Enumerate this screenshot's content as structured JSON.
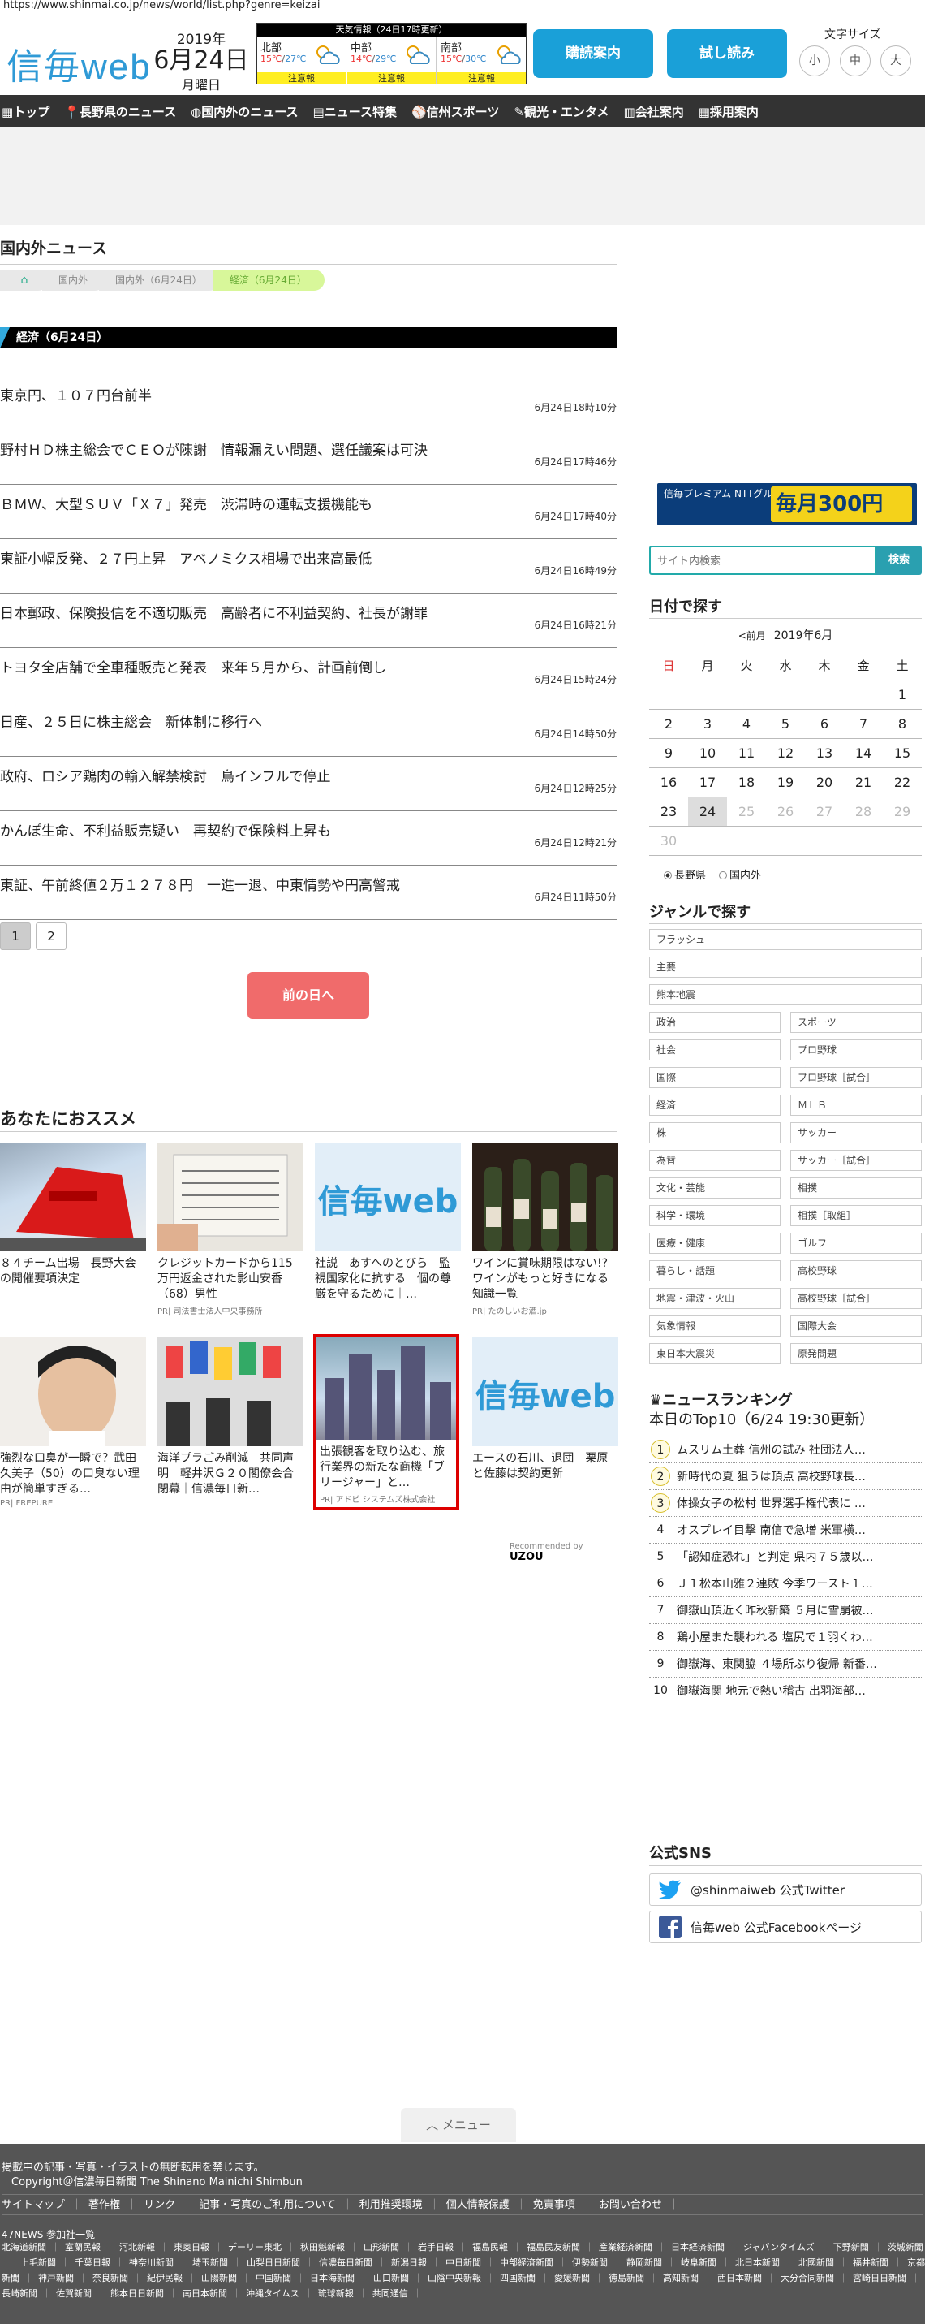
{
  "url": "https://www.shinmai.co.jp/news/world/list.php?genre=keizai",
  "header": {
    "logo_main": "信毎",
    "logo_web": "web",
    "date_year": "2019年",
    "date_main": "6月24日",
    "date_weekday": "月曜日",
    "weather_title": "天気情報（24日17時更新）",
    "weather": [
      {
        "region": "北部",
        "high": "15℃",
        "low": "27℃",
        "warning": "注意報"
      },
      {
        "region": "中部",
        "high": "14℃",
        "low": "29℃",
        "warning": "注意報"
      },
      {
        "region": "南部",
        "high": "15℃",
        "low": "30℃",
        "warning": "注意報"
      }
    ],
    "subscribe_label": "購読案内",
    "trial_label": "試し読み",
    "fontsize_label": "文字サイズ",
    "fontsize": [
      "小",
      "中",
      "大"
    ]
  },
  "nav": [
    {
      "icon": "home-icon",
      "label": "トップ"
    },
    {
      "icon": "pin-icon",
      "label": "長野県のニュース"
    },
    {
      "icon": "globe-icon",
      "label": "国内外のニュース"
    },
    {
      "icon": "document-icon",
      "label": "ニュース特集"
    },
    {
      "icon": "ball-icon",
      "label": "信州スポーツ"
    },
    {
      "icon": "camera-icon",
      "label": "観光・エンタメ"
    },
    {
      "icon": "building-icon",
      "label": "会社案内"
    },
    {
      "icon": "recruit-icon",
      "label": "採用案内"
    }
  ],
  "main": {
    "section_title": "国内外ニュース",
    "breadcrumbs": [
      "国内外",
      "国内外（6月24日）",
      "経済（6月24日）"
    ],
    "category_bar": "経済（6月24日）",
    "articles": [
      {
        "title": "東京円、１０７円台前半",
        "time": "6月24日18時10分"
      },
      {
        "title": "野村ＨＤ株主総会でＣＥＯが陳謝　情報漏えい問題、選任議案は可決",
        "time": "6月24日17時46分"
      },
      {
        "title": "ＢＭＷ、大型ＳＵＶ「Ｘ７」発売　渋滞時の運転支援機能も",
        "time": "6月24日17時40分"
      },
      {
        "title": "東証小幅反発、２７円上昇　アベノミクス相場で出来高最低",
        "time": "6月24日16時49分"
      },
      {
        "title": "日本郵政、保険投信を不適切販売　高齢者に不利益契約、社長が謝罪",
        "time": "6月24日16時21分"
      },
      {
        "title": "トヨタ全店舗で全車種販売と発表　来年５月から、計画前倒し",
        "time": "6月24日15時24分"
      },
      {
        "title": "日産、２５日に株主総会　新体制に移行へ",
        "time": "6月24日14時50分"
      },
      {
        "title": "政府、ロシア鶏肉の輸入解禁検討　鳥インフルで停止",
        "time": "6月24日12時25分"
      },
      {
        "title": "かんぽ生命、不利益販売疑い　再契約で保険料上昇も",
        "time": "6月24日12時21分"
      },
      {
        "title": "東証、午前終値２万１２７８円　一進一退、中東情勢や円高警戒",
        "time": "6月24日11時50分"
      }
    ],
    "pages": [
      "1",
      "2"
    ],
    "prev_day_label": "前の日へ",
    "recommend_title": "あなたにおススメ",
    "recommend": [
      {
        "title": "８４チーム出場　長野大会の開催要項決定",
        "pr": "",
        "img": "red-object"
      },
      {
        "title": "クレジットカードから115万円返金された影山安香（68）男性",
        "pr": "PR| 司法書士法人中央事務所",
        "img": "passbook"
      },
      {
        "title": "社説　あすへのとびら　監視国家化に抗する　個の尊厳を守るために｜…",
        "pr": "",
        "img": "logo"
      },
      {
        "title": "ワインに賞味期限はない!?ワインがもっと好きになる知識一覧",
        "pr": "PR| たのしいお酒.jp",
        "img": "wine"
      },
      {
        "title": "強烈な口臭が一瞬で？武田久美子（50）の口臭ない理由が簡単すぎる…",
        "pr": "PR| FREPURE",
        "img": "man"
      },
      {
        "title": "海洋プラごみ削減　共同声明　軽井沢Ｇ２０閣僚会合閉幕｜信濃毎日新…",
        "pr": "",
        "img": "flags"
      },
      {
        "title": "出張観客を取り込む、旅行業界の新たな商機「ブリージャー」と…",
        "pr": "PR| アドビ システムズ株式会社",
        "img": "city"
      },
      {
        "title": "エースの石川、退団　栗原と佐藤は契約更新",
        "pr": "",
        "img": "logo"
      }
    ],
    "recommended_by": "Recommended by",
    "recommended_brand": "UZOU"
  },
  "side": {
    "promo_left": "信毎プレミアム NTTグループカードでお支払いすると",
    "promo_right": "毎月300円",
    "search_placeholder": "サイト内検索",
    "search_button": "検索",
    "date_title": "日付で探す",
    "cal_prev": "<前月",
    "cal_month": "2019年6月",
    "cal_weekdays": [
      "日",
      "月",
      "火",
      "水",
      "木",
      "金",
      "土"
    ],
    "cal_weeks": [
      [
        "",
        "",
        "",
        "",
        "",
        "",
        "1"
      ],
      [
        "2",
        "3",
        "4",
        "5",
        "6",
        "7",
        "8"
      ],
      [
        "9",
        "10",
        "11",
        "12",
        "13",
        "14",
        "15"
      ],
      [
        "16",
        "17",
        "18",
        "19",
        "20",
        "21",
        "22"
      ],
      [
        "23",
        "24",
        "25",
        "26",
        "27",
        "28",
        "29"
      ],
      [
        "30",
        "",
        "",
        "",
        "",
        "",
        ""
      ]
    ],
    "region_options": [
      "長野県",
      "国内外"
    ],
    "genre_title": "ジャンルで探す",
    "genres_full": [
      "フラッシュ",
      "主要",
      "熊本地震"
    ],
    "genres_pairs": [
      [
        "政治",
        "スポーツ"
      ],
      [
        "社会",
        "プロ野球"
      ],
      [
        "国際",
        "プロ野球［試合］"
      ],
      [
        "経済",
        "ＭＬＢ"
      ],
      [
        "株",
        "サッカー"
      ],
      [
        "為替",
        "サッカー［試合］"
      ],
      [
        "文化・芸能",
        "相撲"
      ],
      [
        "科学・環境",
        "相撲［取組］"
      ],
      [
        "医療・健康",
        "ゴルフ"
      ],
      [
        "暮らし・話題",
        "高校野球"
      ],
      [
        "地震・津波・火山",
        "高校野球［試合］"
      ],
      [
        "気象情報",
        "国際大会"
      ],
      [
        "東日本大震災",
        "原発問題"
      ]
    ],
    "ranking_title": "ニュースランキング",
    "ranking_sub": "本日のTop10（6/24 19:30更新）",
    "ranking": [
      "ムスリム土葬 信州の試み 社団法人…",
      "新時代の夏 狙うは頂点 高校野球長…",
      "体操女子の松村 世界選手権代表に …",
      "オスプレイ目撃 南信で急増 米軍横…",
      "「認知症恐れ」と判定 県内７５歳以…",
      "Ｊ１松本山雅２連敗 今季ワースト１…",
      "御嶽山頂近く昨秋新築 ５月に雪崩被…",
      "鶏小屋また襲われる 塩尻で１羽くわ…",
      "御嶽海、東関脇 ４場所ぶり復帰 新番…",
      "御嶽海関 地元で熱い稽古 出羽海部…"
    ],
    "sns_title": "公式SNS",
    "twitter_label": "@shinmaiweb 公式Twitter",
    "facebook_label": "信毎web 公式Facebookページ"
  },
  "menu_label": "メニュー",
  "footer": {
    "notice": "掲載中の記事・写真・イラストの無断転用を禁じます。",
    "copyright": "Copyright＠信濃毎日新聞 The Shinano Mainichi Shimbun",
    "links": [
      "サイトマップ",
      "著作権",
      "リンク",
      "記事・写真のご利用について",
      "利用推奨環境",
      "個人情報保護",
      "免責事項",
      "お問い合わせ"
    ],
    "news47_label": "47NEWS 参加社一覧",
    "papers": [
      "北海道新聞",
      "室蘭民報",
      "河北新報",
      "東奥日報",
      "デーリー東北",
      "秋田魁新報",
      "山形新聞",
      "岩手日報",
      "福島民報",
      "福島民友新聞",
      "産業経済新聞",
      "日本経済新聞",
      "ジャパンタイムズ",
      "下野新聞",
      "茨城新聞",
      "上毛新聞",
      "千葉日報",
      "神奈川新聞",
      "埼玉新聞",
      "山梨日日新聞",
      "信濃毎日新聞",
      "新潟日報",
      "中日新聞",
      "中部経済新聞",
      "伊勢新聞",
      "静岡新聞",
      "岐阜新聞",
      "北日本新聞",
      "北國新聞",
      "福井新聞",
      "京都新聞",
      "神戸新聞",
      "奈良新聞",
      "紀伊民報",
      "山陽新聞",
      "中国新聞",
      "日本海新聞",
      "山口新聞",
      "山陰中央新報",
      "四国新聞",
      "愛媛新聞",
      "徳島新聞",
      "高知新聞",
      "西日本新聞",
      "大分合同新聞",
      "宮崎日日新聞",
      "長崎新聞",
      "佐賀新聞",
      "熊本日日新聞",
      "南日本新聞",
      "沖縄タイムス",
      "琉球新報",
      "共同通信"
    ]
  },
  "colors": {
    "brand": "#2f9ad6",
    "nav": "#333333",
    "button": "#1aa0d8",
    "prev_day": "#f06b6b",
    "footer": "#555555",
    "category_accent": "#33aadd"
  }
}
